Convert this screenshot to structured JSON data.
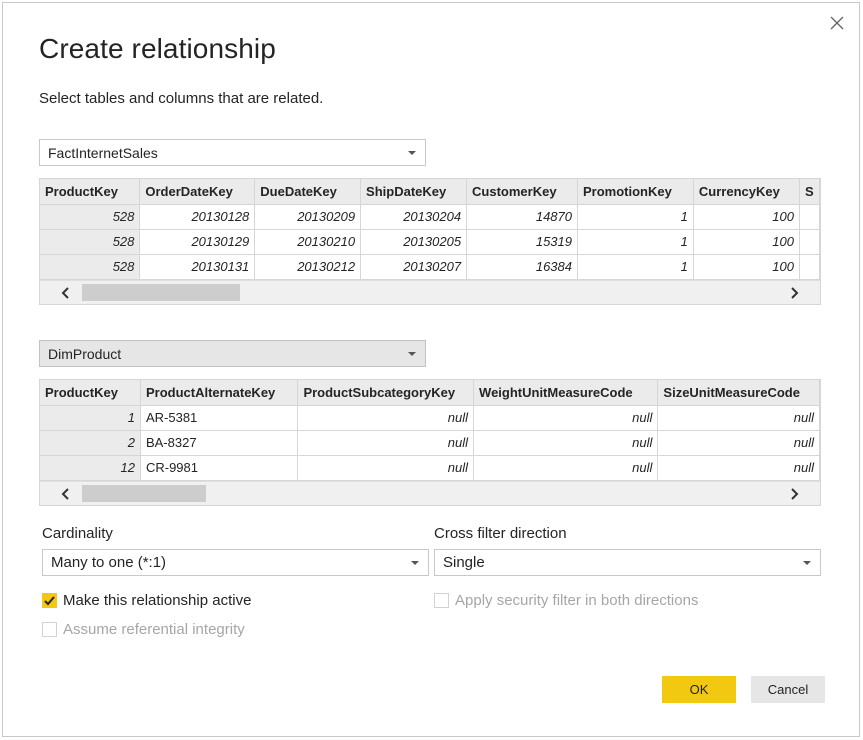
{
  "dialog": {
    "title": "Create relationship",
    "subtitle": "Select tables and columns that are related."
  },
  "table1": {
    "selected": "FactInternetSales",
    "columns": [
      "ProductKey",
      "OrderDateKey",
      "DueDateKey",
      "ShipDateKey",
      "CustomerKey",
      "PromotionKey",
      "CurrencyKey",
      "S"
    ],
    "rows": [
      [
        "528",
        "20130128",
        "20130209",
        "20130204",
        "14870",
        "1",
        "100",
        ""
      ],
      [
        "528",
        "20130129",
        "20130210",
        "20130205",
        "15319",
        "1",
        "100",
        ""
      ],
      [
        "528",
        "20130131",
        "20130212",
        "20130207",
        "16384",
        "1",
        "100",
        ""
      ]
    ]
  },
  "table2": {
    "selected": "DimProduct",
    "columns": [
      "ProductKey",
      "ProductAlternateKey",
      "ProductSubcategoryKey",
      "WeightUnitMeasureCode",
      "SizeUnitMeasureCode"
    ],
    "rows": [
      [
        "1",
        "AR-5381",
        "null",
        "null",
        "null"
      ],
      [
        "2",
        "BA-8327",
        "null",
        "null",
        "null"
      ],
      [
        "12",
        "CR-9981",
        "null",
        "null",
        "null"
      ]
    ]
  },
  "cardinality": {
    "label": "Cardinality",
    "value": "Many to one (*:1)"
  },
  "cross_filter": {
    "label": "Cross filter direction",
    "value": "Single"
  },
  "options": {
    "active": {
      "label": "Make this relationship active",
      "checked": true
    },
    "referential": {
      "label": "Assume referential integrity",
      "checked": false
    },
    "security": {
      "label": "Apply security filter in both directions",
      "checked": false
    }
  },
  "buttons": {
    "ok": "OK",
    "cancel": "Cancel"
  },
  "colors": {
    "accent": "#f2c811",
    "header_bg": "#ebebeb",
    "border": "#d6d6d6"
  },
  "icons": {
    "close": "close-icon",
    "dropdown": "chevron-down-icon",
    "scroll_left": "chevron-left-icon",
    "scroll_right": "chevron-right-icon",
    "check": "checkmark-icon"
  }
}
